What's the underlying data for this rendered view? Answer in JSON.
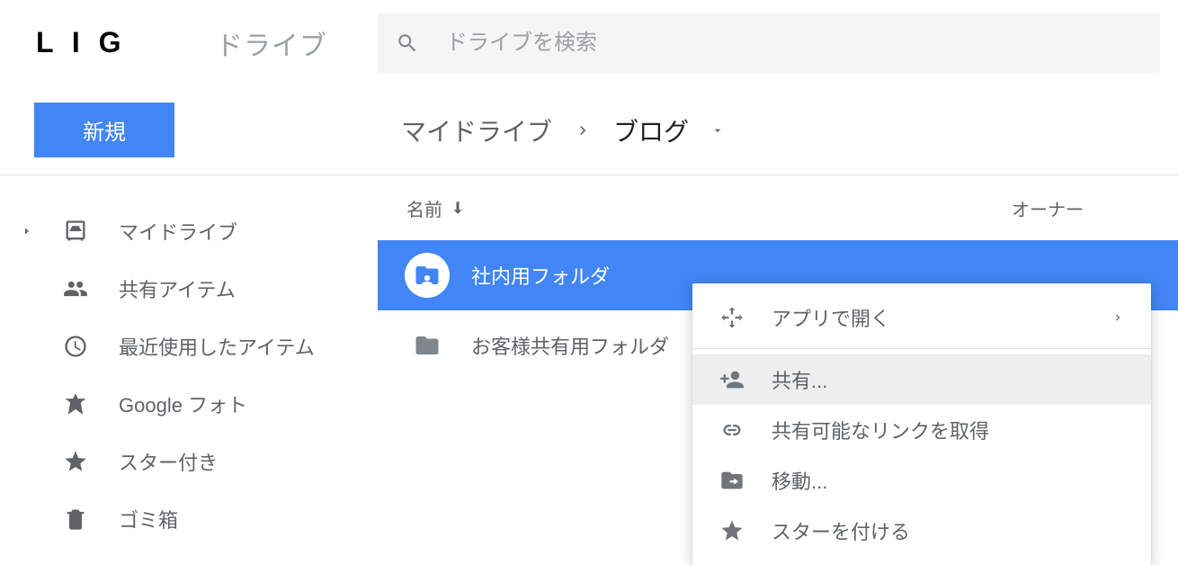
{
  "header": {
    "logo": "L I G",
    "app_name": "ドライブ",
    "search_placeholder": "ドライブを検索"
  },
  "toolbar": {
    "new_label": "新規"
  },
  "breadcrumb": {
    "root": "マイドライブ",
    "current": "ブログ"
  },
  "sidebar": {
    "items": [
      {
        "label": "マイドライブ"
      },
      {
        "label": "共有アイテム"
      },
      {
        "label": "最近使用したアイテム"
      },
      {
        "label": "Google フォト"
      },
      {
        "label": "スター付き"
      },
      {
        "label": "ゴミ箱"
      }
    ]
  },
  "list": {
    "headers": {
      "name": "名前",
      "owner": "オーナー"
    },
    "rows": [
      {
        "name": "社内用フォルダ",
        "selected": true,
        "shared": true
      },
      {
        "name": "お客様共有用フォルダ",
        "selected": false,
        "shared": false
      }
    ]
  },
  "context_menu": {
    "open_with": "アプリで開く",
    "share": "共有...",
    "get_link": "共有可能なリンクを取得",
    "move": "移動...",
    "star": "スターを付ける"
  },
  "colors": {
    "accent": "#4285f4"
  }
}
